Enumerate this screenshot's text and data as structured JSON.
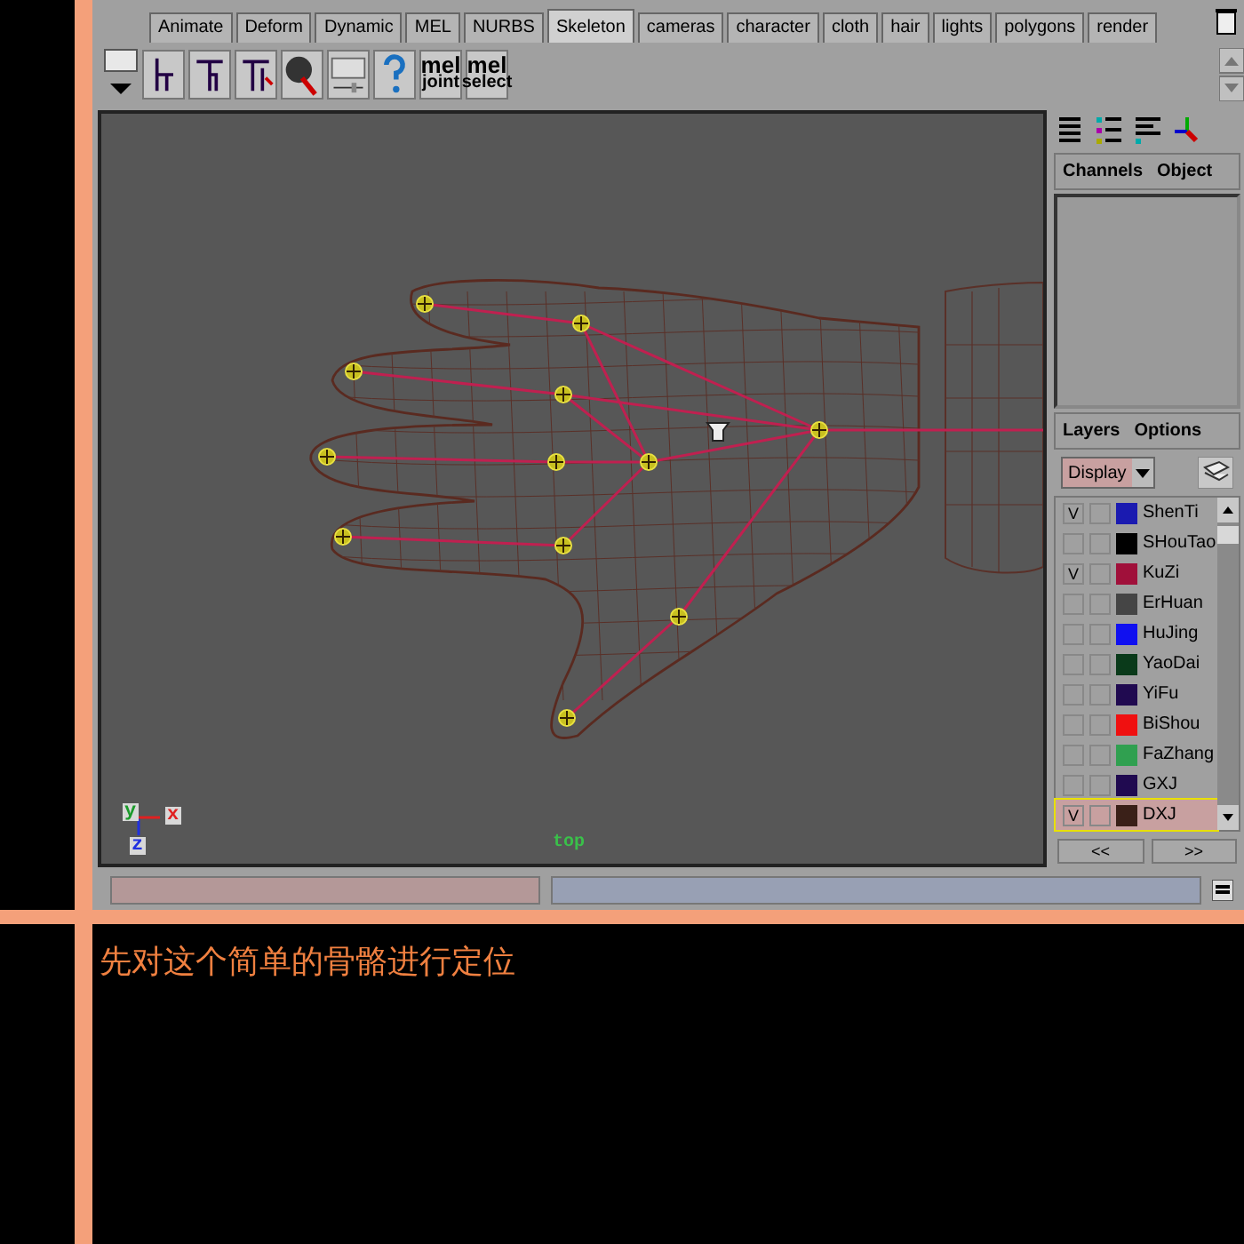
{
  "tabs": [
    {
      "label": "Animate",
      "selected": false
    },
    {
      "label": "Deform",
      "selected": false
    },
    {
      "label": "Dynamic",
      "selected": false
    },
    {
      "label": "MEL",
      "selected": false
    },
    {
      "label": "NURBS",
      "selected": false
    },
    {
      "label": "Skeleton",
      "selected": true
    },
    {
      "label": "cameras",
      "selected": false
    },
    {
      "label": "character",
      "selected": false
    },
    {
      "label": "cloth",
      "selected": false
    },
    {
      "label": "hair",
      "selected": false
    },
    {
      "label": "lights",
      "selected": false
    },
    {
      "label": "polygons",
      "selected": false
    },
    {
      "label": "render",
      "selected": false
    }
  ],
  "shelf": {
    "mel_buttons": [
      {
        "top": "mel",
        "bottom": "joint"
      },
      {
        "top": "mel",
        "bottom": "select"
      }
    ]
  },
  "viewport": {
    "camera": "top",
    "axes": [
      {
        "label": "y",
        "color": "#1a9a2a"
      },
      {
        "label": "x",
        "color": "#e02020"
      },
      {
        "label": "z",
        "color": "#2030e0"
      }
    ]
  },
  "channel_box": {
    "menus": [
      "Channels",
      "Object"
    ]
  },
  "layer_editor": {
    "menus": [
      "Layers",
      "Options"
    ],
    "mode": "Display",
    "scroll_buttons": [
      "<<",
      ">>"
    ],
    "layers": [
      {
        "name": "ShenTi",
        "visible_mark": "V",
        "color": "#1a1ab0",
        "selected": false
      },
      {
        "name": "SHouTao",
        "color": "#000000",
        "selected": false
      },
      {
        "name": "KuZi",
        "visible_mark": "V",
        "color": "#a0103a",
        "selected": false
      },
      {
        "name": "ErHuan",
        "color": "#454545",
        "selected": false
      },
      {
        "name": "HuJing",
        "color": "#1010f0",
        "selected": false
      },
      {
        "name": "YaoDai",
        "color": "#0a3a1a",
        "selected": false
      },
      {
        "name": "YiFu",
        "color": "#200a50",
        "selected": false
      },
      {
        "name": "BiShou",
        "color": "#f01010",
        "selected": false
      },
      {
        "name": "FaZhang",
        "color": "#30a050",
        "selected": false
      },
      {
        "name": "GXJ",
        "color": "#200a50",
        "selected": false
      },
      {
        "name": "DXJ",
        "visible_mark": "V",
        "color": "#3a2018",
        "selected": true
      }
    ]
  },
  "caption": "先对这个简单的骨骼进行定位"
}
